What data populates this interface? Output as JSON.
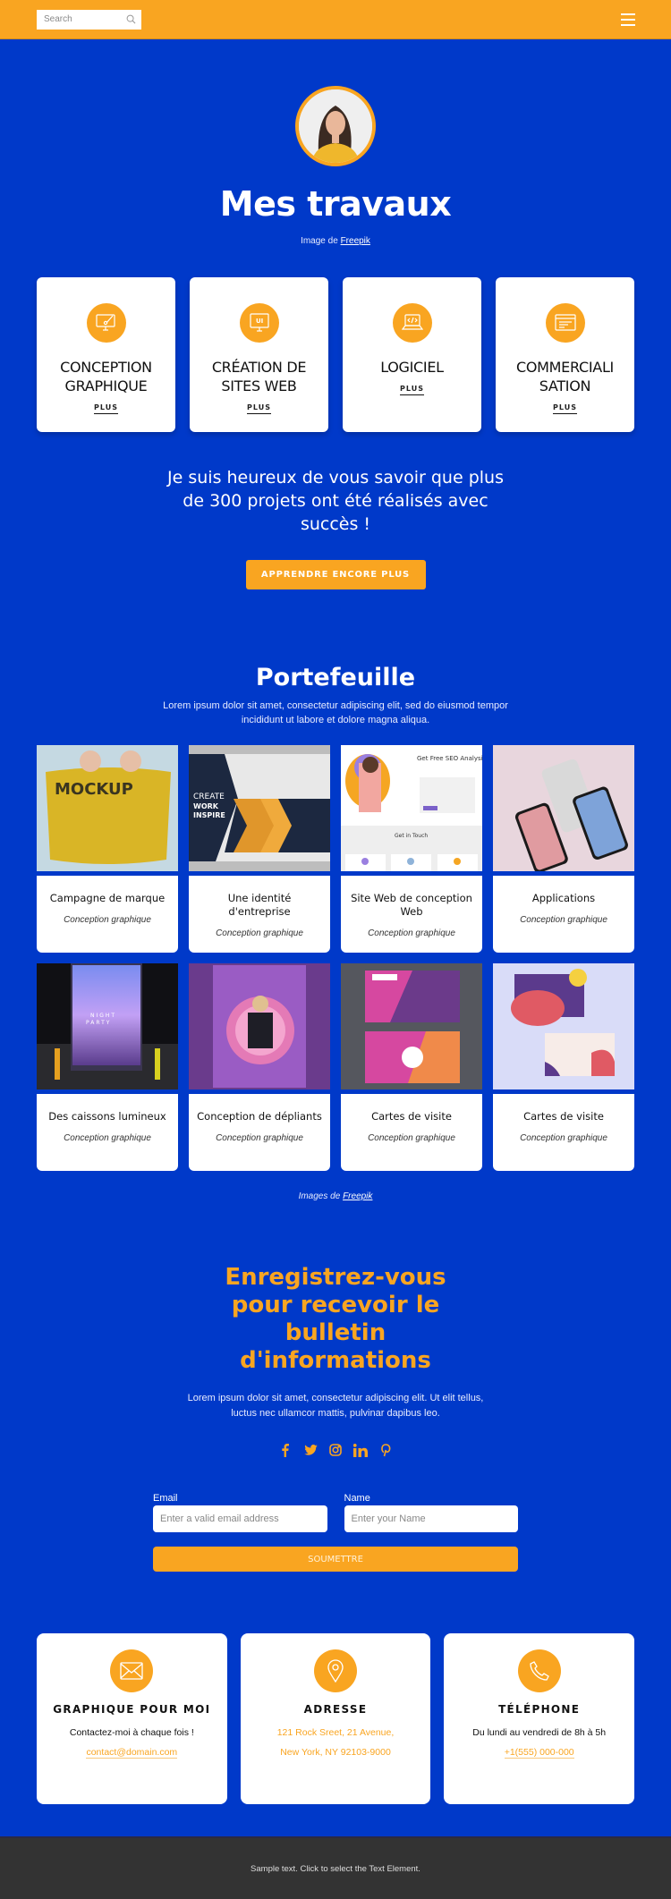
{
  "header": {
    "search_placeholder": "Search",
    "menu_icon": "hamburger-icon"
  },
  "hero": {
    "title": "Mes travaux",
    "credit_prefix": "Image de ",
    "credit_link": "Freepik"
  },
  "services": [
    {
      "title": "CONCEPTION GRAPHIQUE",
      "icon": "monitor-brush-icon",
      "more": "PLUS"
    },
    {
      "title": "CRÉATION DE SITES WEB",
      "icon": "monitor-ui-icon",
      "more": "PLUS"
    },
    {
      "title": "LOGICIEL",
      "icon": "laptop-code-icon",
      "more": "PLUS"
    },
    {
      "title": "COMMERCIALI SATION",
      "icon": "browser-window-icon",
      "more": "PLUS"
    }
  ],
  "tagline": "Je suis heureux de vous savoir que plus de 300 projets ont été réalisés avec succès !",
  "cta_label": "APPRENDRE ENCORE PLUS",
  "portfolio": {
    "title": "Portefeuille",
    "lead": "Lorem ipsum dolor sit amet, consectetur adipiscing elit, sed do eiusmod tempor incididunt ut labore et dolore magna aliqua.",
    "items": [
      {
        "title": "Campagne de marque",
        "subtitle": "Conception graphique",
        "image": "mockup-bag"
      },
      {
        "title": "Une identité d'entreprise",
        "subtitle": "Conception graphique",
        "image": "business-template"
      },
      {
        "title": "Site Web de conception Web",
        "subtitle": "Conception graphique",
        "image": "seo-landing-page"
      },
      {
        "title": "Applications",
        "subtitle": "Conception graphique",
        "image": "iphone-mockups"
      },
      {
        "title": "Des caissons lumineux",
        "subtitle": "Conception graphique",
        "image": "night-party-lightbox"
      },
      {
        "title": "Conception de dépliants",
        "subtitle": "Conception graphique",
        "image": "purple-flyer"
      },
      {
        "title": "Cartes de visite",
        "subtitle": "Conception graphique",
        "image": "pink-business-cards"
      },
      {
        "title": "Cartes de visite",
        "subtitle": "Conception graphique",
        "image": "pastel-business-cards"
      }
    ],
    "credit_prefix": "Images de ",
    "credit_link": "Freepik"
  },
  "newsletter": {
    "title": "Enregistrez-vous pour recevoir le bulletin d'informations",
    "lead": "Lorem ipsum dolor sit amet, consectetur adipiscing elit. Ut elit tellus, luctus nec ullamcor mattis, pulvinar dapibus leo.",
    "social": [
      "facebook-icon",
      "twitter-icon",
      "instagram-icon",
      "linkedin-icon",
      "pinterest-icon"
    ],
    "email_label": "Email",
    "email_placeholder": "Enter a valid email address",
    "name_label": "Name",
    "name_placeholder": "Enter your Name",
    "submit_label": "SOUMETTRE"
  },
  "contacts": [
    {
      "title": "GRAPHIQUE POUR MOI",
      "icon": "envelope-icon",
      "line1": "Contactez-moi à chaque fois !",
      "line2": "contact@domain.com"
    },
    {
      "title": "ADRESSE",
      "icon": "map-pin-icon",
      "line1": "121 Rock Sreet, 21 Avenue,",
      "line2": "New York, NY 92103-9000"
    },
    {
      "title": "TÉLÉPHONE",
      "icon": "phone-icon",
      "line1": "Du lundi au vendredi de 8h à 5h",
      "line2": "+1(555) 000-000"
    }
  ],
  "footer": {
    "text": "Sample text. Click to select the Text Element."
  },
  "colors": {
    "primary_blue": "#0039c9",
    "accent_orange": "#f9a521",
    "footer_gray": "#333333"
  }
}
